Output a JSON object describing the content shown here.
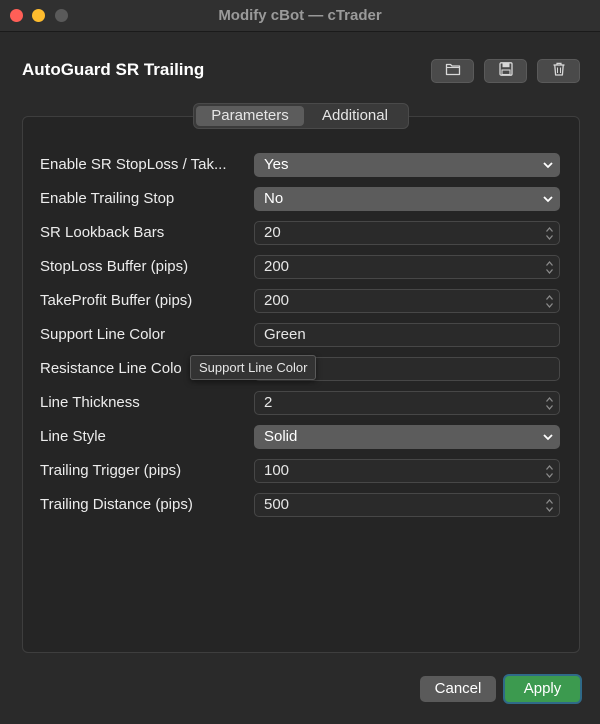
{
  "window": {
    "title": "Modify cBot — cTrader"
  },
  "header": {
    "title": "AutoGuard SR Trailing"
  },
  "toolbar": {
    "open_icon": "folder-icon",
    "save_icon": "save-icon",
    "delete_icon": "trash-icon"
  },
  "tabs": [
    {
      "label": "Parameters",
      "active": true
    },
    {
      "label": "Additional",
      "active": false
    }
  ],
  "parameters": [
    {
      "label": "Enable SR StopLoss / Tak...",
      "value": "Yes",
      "kind": "select"
    },
    {
      "label": "Enable Trailing Stop",
      "value": "No",
      "kind": "select"
    },
    {
      "label": "SR Lookback Bars",
      "value": "20",
      "kind": "number"
    },
    {
      "label": "StopLoss Buffer (pips)",
      "value": "200",
      "kind": "number"
    },
    {
      "label": "TakeProfit Buffer (pips)",
      "value": "200",
      "kind": "number"
    },
    {
      "label": "Support Line Color",
      "value": "Green",
      "kind": "text"
    },
    {
      "label": "Resistance Line Colo",
      "value": "",
      "kind": "text"
    },
    {
      "label": "Line Thickness",
      "value": "2",
      "kind": "number"
    },
    {
      "label": "Line Style",
      "value": "Solid",
      "kind": "select"
    },
    {
      "label": "Trailing Trigger (pips)",
      "value": "100",
      "kind": "number"
    },
    {
      "label": "Trailing Distance (pips)",
      "value": "500",
      "kind": "number"
    }
  ],
  "tooltip": {
    "text": "Support Line Color"
  },
  "footer": {
    "cancel_label": "Cancel",
    "apply_label": "Apply"
  },
  "colors": {
    "apply": "#3c9a4f",
    "close": "#ff5f57",
    "minimize": "#febc2e"
  }
}
